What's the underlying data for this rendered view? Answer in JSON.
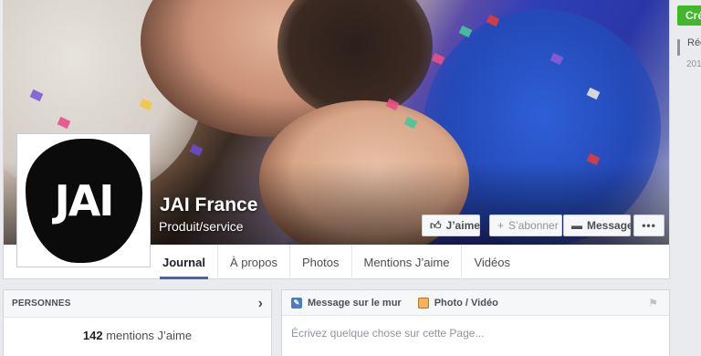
{
  "page": {
    "name": "JAI France",
    "category": "Produit/service",
    "logo_text": "JAI"
  },
  "cover_actions": {
    "like": "J’aime",
    "follow": "S’abonner",
    "message": "Message",
    "more": "•••"
  },
  "tabs": [
    "Journal",
    "À propos",
    "Photos",
    "Mentions J’aime",
    "Vidéos"
  ],
  "active_tab": "Journal",
  "people": {
    "title": "PERSONNES",
    "likes_count": "142",
    "likes_label": "mentions J’aime"
  },
  "composer": {
    "tab_status": "Message sur le mur",
    "tab_photo": "Photo / Vidéo",
    "placeholder": "Écrivez quelque chose sur cette Page..."
  },
  "right_column": {
    "create_button": "Cré",
    "text_1": "Réc",
    "text_2": "201"
  },
  "colors": {
    "accent": "#4267b2",
    "create_green": "#42b72a",
    "page_bg": "#e9ebee"
  }
}
